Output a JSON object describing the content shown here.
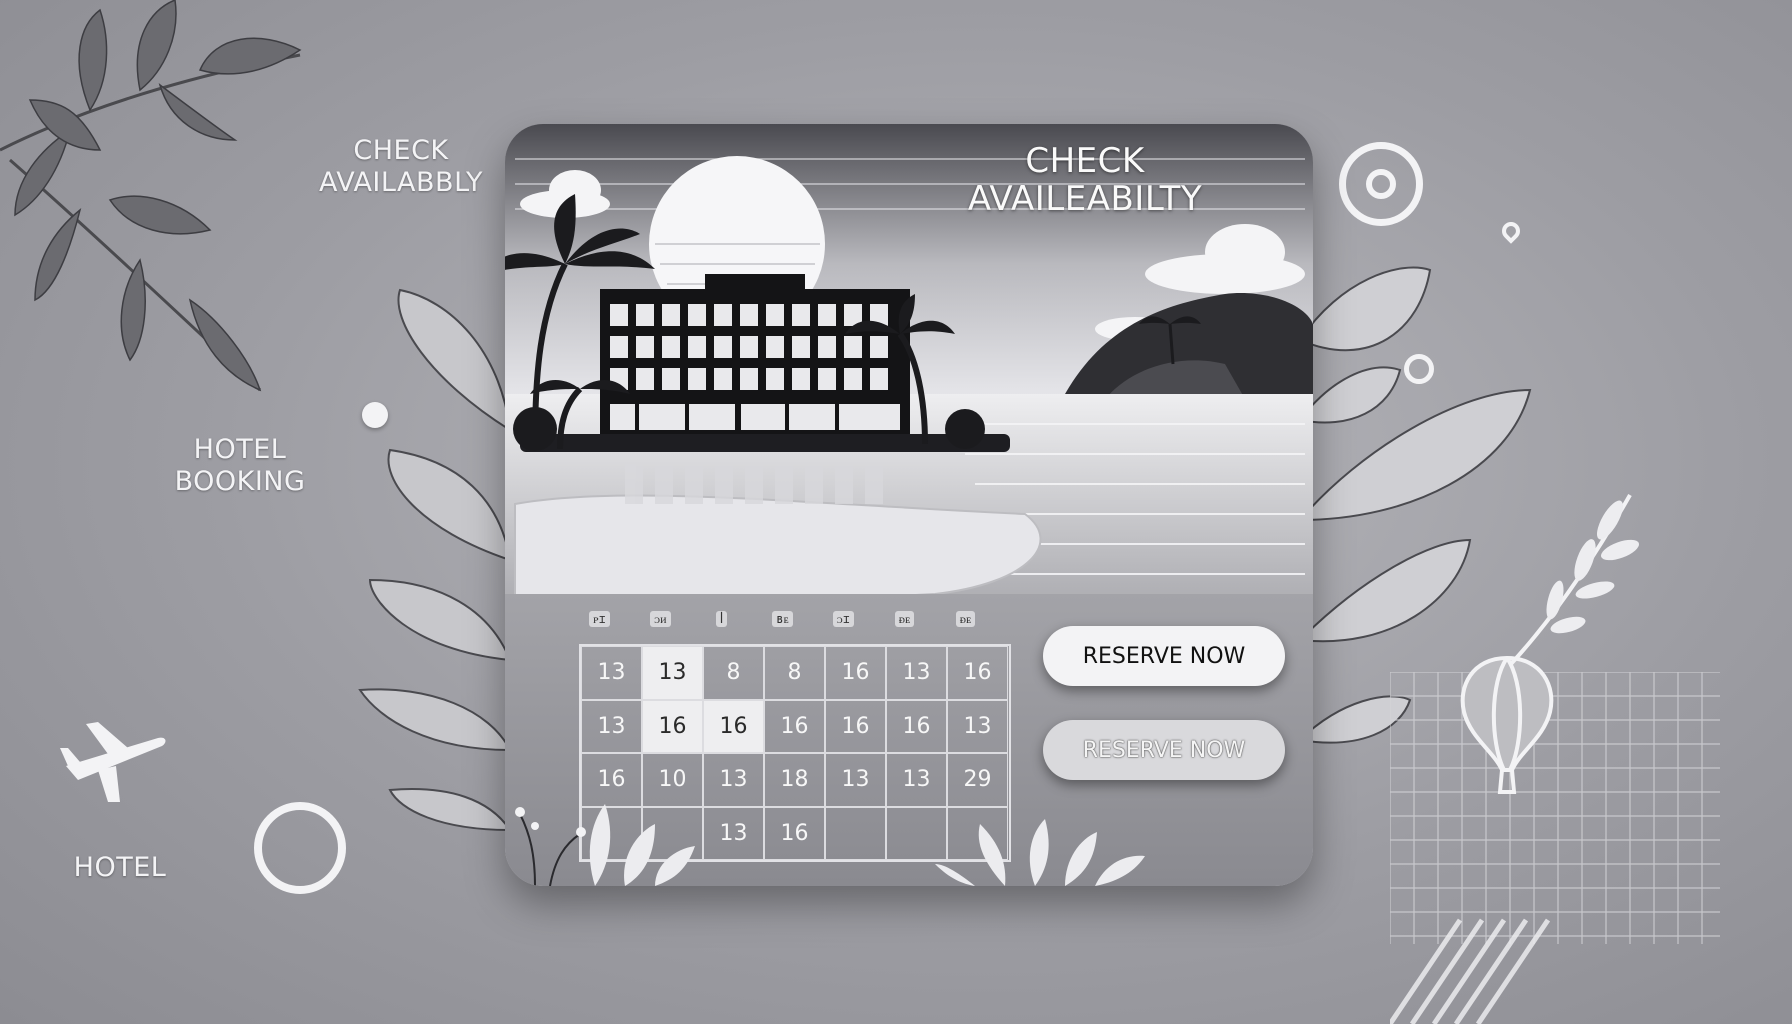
{
  "side_labels": {
    "check_availability": "CHECK\nAVAILABBLY",
    "hotel_booking": "HOTEL\nBOOKING",
    "hotel": "HOTEL"
  },
  "card": {
    "title": "CHECK\nAVAILEABILTY",
    "weekdays": [
      "ᴘɪ",
      "ᴐᴎ",
      "ꟾ",
      "ʙᴇ",
      "ᴐɪ",
      "ᴆᴇ",
      "ᴆᴇ"
    ],
    "calendar_rows": [
      [
        "13",
        "13",
        "8",
        "8",
        "16",
        "13",
        "16"
      ],
      [
        "13",
        "16",
        "16",
        "16",
        "16",
        "16",
        "13"
      ],
      [
        "16",
        "10",
        "13",
        "18",
        "13",
        "13",
        "29"
      ],
      [
        "",
        "",
        "13",
        "16",
        "",
        "",
        ""
      ]
    ],
    "reserve_primary": "RESERVE NOW",
    "reserve_secondary": "RESERVE NOW"
  },
  "colors": {
    "background": "#9d9da3",
    "card_frame": "#d8d8dc",
    "button": "#f3f3f5"
  }
}
